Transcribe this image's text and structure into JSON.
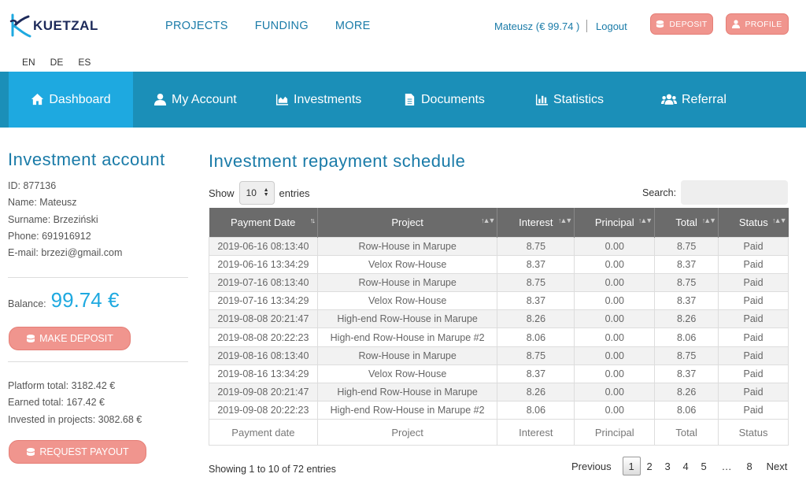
{
  "brand": {
    "name": "KUETZAL"
  },
  "main_nav": [
    "PROJECTS",
    "FUNDING",
    "MORE"
  ],
  "user": {
    "info": "Mateusz (€ 99.74 )",
    "logout": "Logout"
  },
  "top_buttons": {
    "deposit": "DEPOSIT",
    "profile": "PROFILE"
  },
  "languages": [
    "EN",
    "DE",
    "ES"
  ],
  "dashboard_nav": [
    {
      "label": "Dashboard",
      "icon": "home-icon",
      "active": true
    },
    {
      "label": "My Account",
      "icon": "user-icon"
    },
    {
      "label": "Investments",
      "icon": "area-chart-icon"
    },
    {
      "label": "Documents",
      "icon": "document-icon"
    },
    {
      "label": "Statistics",
      "icon": "bar-chart-icon"
    },
    {
      "label": "Referral",
      "icon": "users-icon"
    }
  ],
  "sidebar": {
    "title": "Investment account",
    "id_line": "ID: 877136",
    "name_line": "Name: Mateusz",
    "surname_line": "Surname: Brzeziński",
    "phone_line": "Phone: 691916912",
    "email_line": "E-mail: brzezi@gmail.com",
    "balance_label": "Balance:",
    "balance_value": "99.74 €",
    "make_deposit": "MAKE DEPOSIT",
    "platform_total": "Platform total: 3182.42 €",
    "earned_total": "Earned total: 167.42 €",
    "invested_total": "Invested in projects: 3082.68 €",
    "request_payout": "REQUEST PAYOUT"
  },
  "main": {
    "title": "Investment repayment schedule",
    "show_label": "Show",
    "entries_value": "10",
    "entries_label": "entries",
    "search_label": "Search:",
    "columns": [
      "Payment Date",
      "Project",
      "Interest",
      "Principal",
      "Total",
      "Status"
    ],
    "rows": [
      [
        "2019-06-16 08:13:40",
        "Row-House in Marupe",
        "8.75",
        "0.00",
        "8.75",
        "Paid"
      ],
      [
        "2019-06-16 13:34:29",
        "Velox Row-House",
        "8.37",
        "0.00",
        "8.37",
        "Paid"
      ],
      [
        "2019-07-16 08:13:40",
        "Row-House in Marupe",
        "8.75",
        "0.00",
        "8.75",
        "Paid"
      ],
      [
        "2019-07-16 13:34:29",
        "Velox Row-House",
        "8.37",
        "0.00",
        "8.37",
        "Paid"
      ],
      [
        "2019-08-08 20:21:47",
        "High-end Row-House in Marupe",
        "8.26",
        "0.00",
        "8.26",
        "Paid"
      ],
      [
        "2019-08-08 20:22:23",
        "High-end Row-House in Marupe #2",
        "8.06",
        "0.00",
        "8.06",
        "Paid"
      ],
      [
        "2019-08-16 08:13:40",
        "Row-House in Marupe",
        "8.75",
        "0.00",
        "8.75",
        "Paid"
      ],
      [
        "2019-08-16 13:34:29",
        "Velox Row-House",
        "8.37",
        "0.00",
        "8.37",
        "Paid"
      ],
      [
        "2019-09-08 20:21:47",
        "High-end Row-House in Marupe",
        "8.26",
        "0.00",
        "8.26",
        "Paid"
      ],
      [
        "2019-09-08 20:22:23",
        "High-end Row-House in Marupe #2",
        "8.06",
        "0.00",
        "8.06",
        "Paid"
      ]
    ],
    "footer_columns": [
      "Payment date",
      "Project",
      "Interest",
      "Principal",
      "Total",
      "Status"
    ],
    "showing": "Showing 1 to 10 of 72 entries",
    "pager": {
      "previous": "Previous",
      "pages": [
        "1",
        "2",
        "3",
        "4",
        "5",
        "…",
        "8"
      ],
      "next": "Next",
      "current": "1"
    }
  },
  "colors": {
    "accent_blue": "#1b8fb8",
    "active_blue": "#1ea9e0",
    "button_pink": "#f0958e",
    "title_blue": "#1a7ba8"
  }
}
